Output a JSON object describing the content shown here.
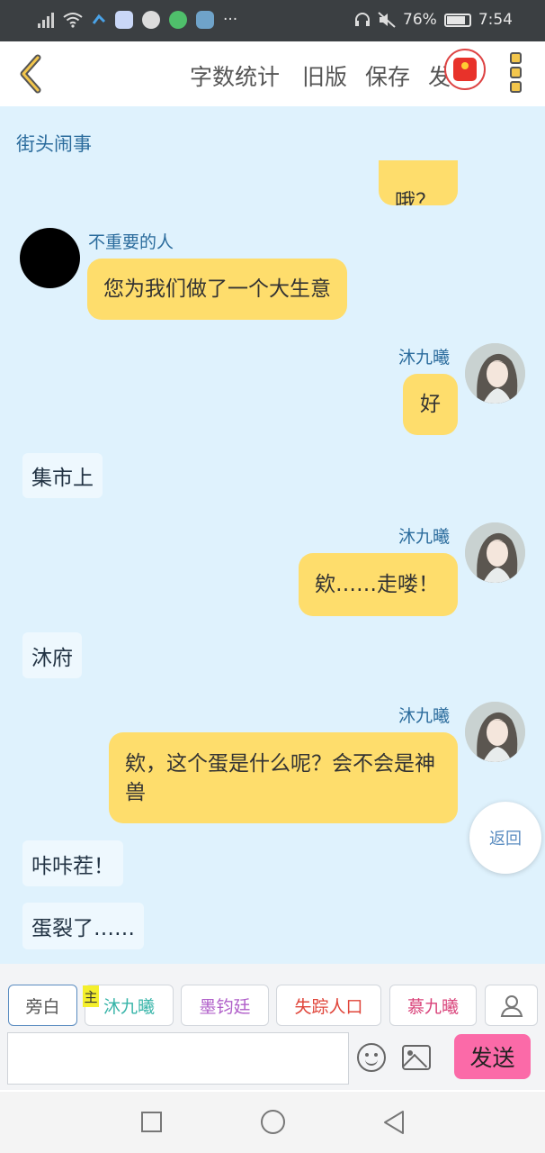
{
  "status_bar": {
    "battery_percent": "76%",
    "time": "7:54",
    "more_indicator": "···",
    "icons": [
      "signal-icon",
      "wifi-icon",
      "notification-icon",
      "baidu-icon",
      "app-icon",
      "chat-icon",
      "app-icon-2",
      "headset-icon",
      "mute-icon",
      "battery-icon"
    ]
  },
  "toolbar": {
    "back_icon": "chevron-left-icon",
    "word_count_label": "字数统计",
    "old_version_label": "旧版",
    "save_label": "保存",
    "publish_label": "发",
    "red_packet_icon": "red-packet-icon",
    "more_icon": "more-vertical-icon"
  },
  "chat": {
    "scene_title": "街头闹事",
    "messages": [
      {
        "type": "bubble",
        "side": "right",
        "text": "哦？"
      },
      {
        "type": "bubble",
        "side": "left",
        "speaker": "不重要的人",
        "text": "您为我们做了一个大生意"
      },
      {
        "type": "bubble",
        "side": "right",
        "speaker": "沐九曦",
        "text": "好"
      },
      {
        "type": "narration",
        "text": "集市上"
      },
      {
        "type": "bubble",
        "side": "right",
        "speaker": "沐九曦",
        "text": "欸……走喽！"
      },
      {
        "type": "narration",
        "text": "沐府"
      },
      {
        "type": "bubble",
        "side": "right",
        "speaker": "沐九曦",
        "text": "欸，这个蛋是什么呢？会不会是神兽"
      },
      {
        "type": "narration",
        "text": "咔咔茬！"
      },
      {
        "type": "narration",
        "text": "蛋裂了……"
      }
    ],
    "return_label": "返回"
  },
  "characters": {
    "main_tag": "主",
    "items": [
      {
        "label": "旁白",
        "color": "#555555",
        "selected": true
      },
      {
        "label": "沐九曦",
        "color": "#36b4a8",
        "selected": false
      },
      {
        "label": "墨钧廷",
        "color": "#b05fc9",
        "selected": false
      },
      {
        "label": "失踪人口",
        "color": "#e0453a",
        "selected": false
      },
      {
        "label": "慕九曦",
        "color": "#d9437a",
        "selected": false
      }
    ],
    "add_icon": "user-icon"
  },
  "composer": {
    "input_value": "",
    "input_placeholder": "",
    "emoji_icon": "emoji-icon",
    "image_icon": "image-icon",
    "send_label": "发送",
    "send_color": "#fb6aa8"
  },
  "nav_bar": {
    "icons": [
      "square-icon",
      "circle-icon",
      "triangle-back-icon"
    ]
  }
}
